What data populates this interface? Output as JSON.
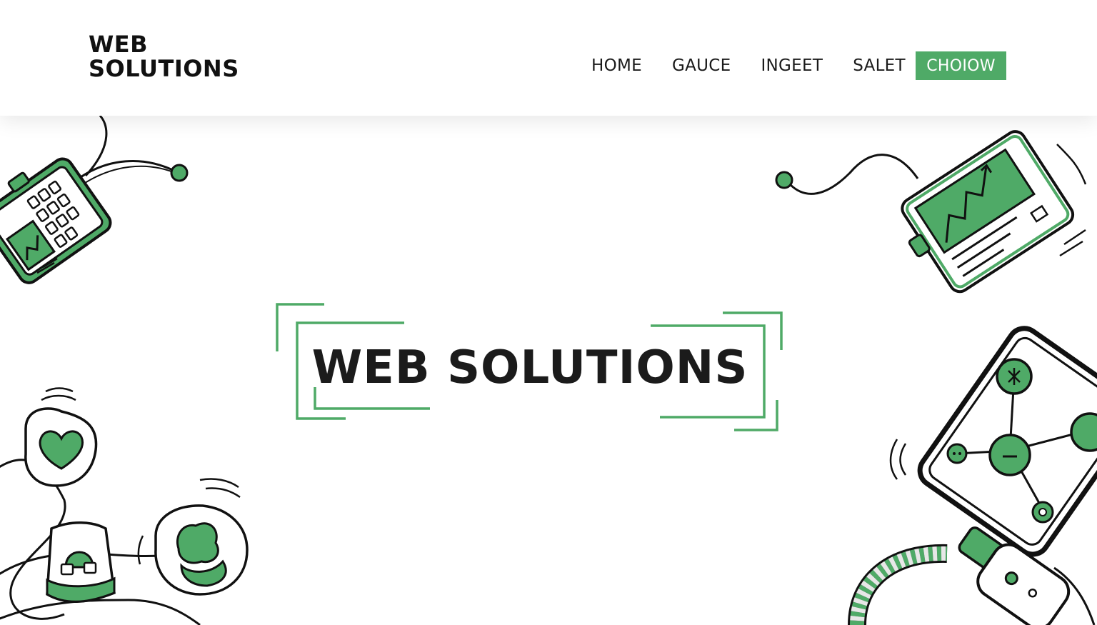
{
  "header": {
    "logo_line1": "WEB",
    "logo_line2": "SOLUTIONS"
  },
  "nav": {
    "items": [
      {
        "label": "HOME"
      },
      {
        "label": "GAUCE"
      },
      {
        "label": "INGEET"
      },
      {
        "label": "SALET"
      }
    ],
    "cta_label": "CHOIOW"
  },
  "hero": {
    "title": "WEB SOLUTIONS"
  },
  "colors": {
    "accent": "#4faa67",
    "ink": "#111111",
    "background": "#ffffff"
  },
  "illustrations": {
    "top_left": "handheld-keypad-device-icon",
    "top_right": "chart-monitor-device-icon",
    "bottom_left": "heart-and-device-bubbles-icon",
    "bottom_right": "network-tablet-icon",
    "bottom_right_corner": "striped-cable-plug-icon"
  }
}
